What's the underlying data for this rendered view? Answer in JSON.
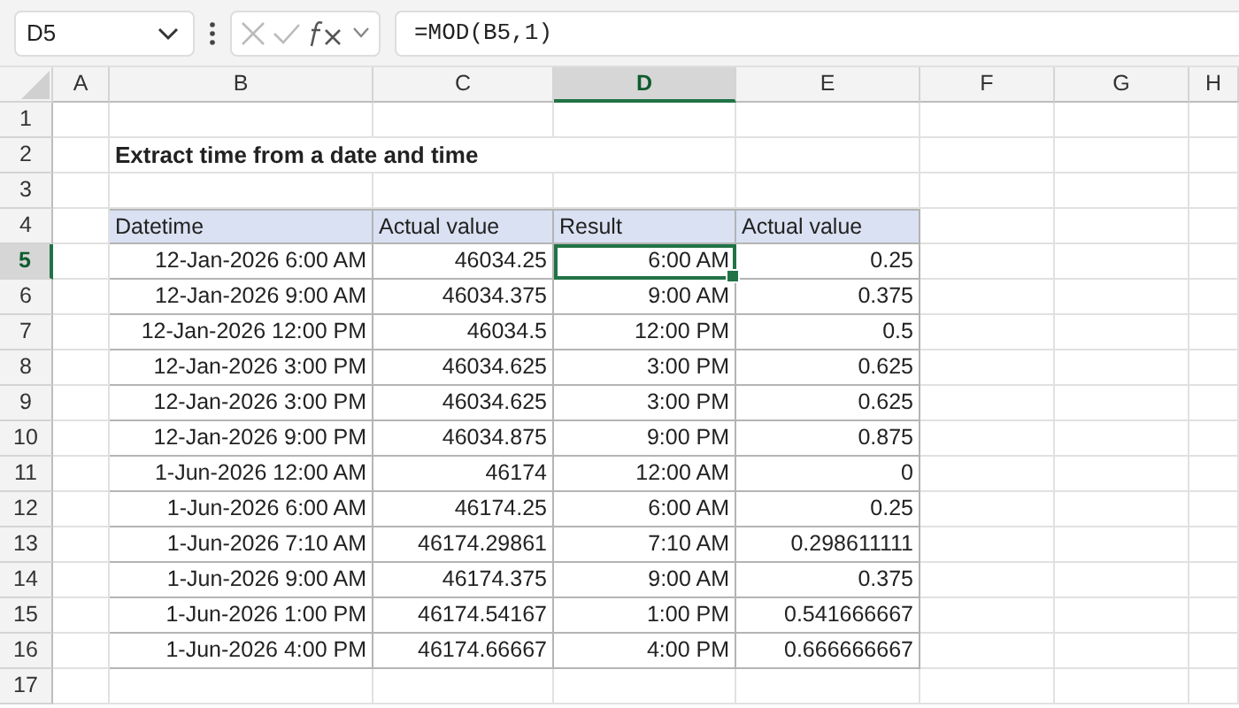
{
  "name_box": "D5",
  "formula": "=MOD(B5,1)",
  "column_headers": [
    {
      "label": "A",
      "selected": false
    },
    {
      "label": "B",
      "selected": false
    },
    {
      "label": "C",
      "selected": false
    },
    {
      "label": "D",
      "selected": true
    },
    {
      "label": "E",
      "selected": false
    },
    {
      "label": "F",
      "selected": false
    },
    {
      "label": "G",
      "selected": false
    },
    {
      "label": "H",
      "selected": false
    }
  ],
  "row_headers": [
    {
      "label": "1",
      "selected": false
    },
    {
      "label": "2",
      "selected": false
    },
    {
      "label": "3",
      "selected": false
    },
    {
      "label": "4",
      "selected": false
    },
    {
      "label": "5",
      "selected": true
    },
    {
      "label": "6",
      "selected": false
    },
    {
      "label": "7",
      "selected": false
    },
    {
      "label": "8",
      "selected": false
    },
    {
      "label": "9",
      "selected": false
    },
    {
      "label": "10",
      "selected": false
    },
    {
      "label": "11",
      "selected": false
    },
    {
      "label": "12",
      "selected": false
    },
    {
      "label": "13",
      "selected": false
    },
    {
      "label": "14",
      "selected": false
    },
    {
      "label": "15",
      "selected": false
    },
    {
      "label": "16",
      "selected": false
    },
    {
      "label": "17",
      "selected": false
    }
  ],
  "title": "Extract time from a date and time",
  "table": {
    "columns": [
      "Datetime",
      "Actual value",
      "Result",
      "Actual value"
    ],
    "rows": [
      {
        "cells": [
          {
            "text": "12-Jan-2026 6:00 AM",
            "selected": false
          },
          {
            "text": "46034.25",
            "selected": false
          },
          {
            "text": "6:00 AM",
            "selected": true
          },
          {
            "text": "0.25",
            "selected": false
          }
        ]
      },
      {
        "cells": [
          {
            "text": "12-Jan-2026 9:00 AM",
            "selected": false
          },
          {
            "text": "46034.375",
            "selected": false
          },
          {
            "text": "9:00 AM",
            "selected": false
          },
          {
            "text": "0.375",
            "selected": false
          }
        ]
      },
      {
        "cells": [
          {
            "text": "12-Jan-2026 12:00 PM",
            "selected": false
          },
          {
            "text": "46034.5",
            "selected": false
          },
          {
            "text": "12:00 PM",
            "selected": false
          },
          {
            "text": "0.5",
            "selected": false
          }
        ]
      },
      {
        "cells": [
          {
            "text": "12-Jan-2026 3:00 PM",
            "selected": false
          },
          {
            "text": "46034.625",
            "selected": false
          },
          {
            "text": "3:00 PM",
            "selected": false
          },
          {
            "text": "0.625",
            "selected": false
          }
        ]
      },
      {
        "cells": [
          {
            "text": "12-Jan-2026 3:00 PM",
            "selected": false
          },
          {
            "text": "46034.625",
            "selected": false
          },
          {
            "text": "3:00 PM",
            "selected": false
          },
          {
            "text": "0.625",
            "selected": false
          }
        ]
      },
      {
        "cells": [
          {
            "text": "12-Jan-2026 9:00 PM",
            "selected": false
          },
          {
            "text": "46034.875",
            "selected": false
          },
          {
            "text": "9:00 PM",
            "selected": false
          },
          {
            "text": "0.875",
            "selected": false
          }
        ]
      },
      {
        "cells": [
          {
            "text": "1-Jun-2026 12:00 AM",
            "selected": false
          },
          {
            "text": "46174",
            "selected": false
          },
          {
            "text": "12:00 AM",
            "selected": false
          },
          {
            "text": "0",
            "selected": false
          }
        ]
      },
      {
        "cells": [
          {
            "text": "1-Jun-2026 6:00 AM",
            "selected": false
          },
          {
            "text": "46174.25",
            "selected": false
          },
          {
            "text": "6:00 AM",
            "selected": false
          },
          {
            "text": "0.25",
            "selected": false
          }
        ]
      },
      {
        "cells": [
          {
            "text": "1-Jun-2026 7:10 AM",
            "selected": false
          },
          {
            "text": "46174.29861",
            "selected": false
          },
          {
            "text": "7:10 AM",
            "selected": false
          },
          {
            "text": "0.298611111",
            "selected": false
          }
        ]
      },
      {
        "cells": [
          {
            "text": "1-Jun-2026 9:00 AM",
            "selected": false
          },
          {
            "text": "46174.375",
            "selected": false
          },
          {
            "text": "9:00 AM",
            "selected": false
          },
          {
            "text": "0.375",
            "selected": false
          }
        ]
      },
      {
        "cells": [
          {
            "text": "1-Jun-2026 1:00 PM",
            "selected": false
          },
          {
            "text": "46174.54167",
            "selected": false
          },
          {
            "text": "1:00 PM",
            "selected": false
          },
          {
            "text": "0.541666667",
            "selected": false
          }
        ]
      },
      {
        "cells": [
          {
            "text": "1-Jun-2026 4:00 PM",
            "selected": false
          },
          {
            "text": "46174.66667",
            "selected": false
          },
          {
            "text": "4:00 PM",
            "selected": false
          },
          {
            "text": "0.666666667",
            "selected": false
          }
        ]
      }
    ]
  }
}
